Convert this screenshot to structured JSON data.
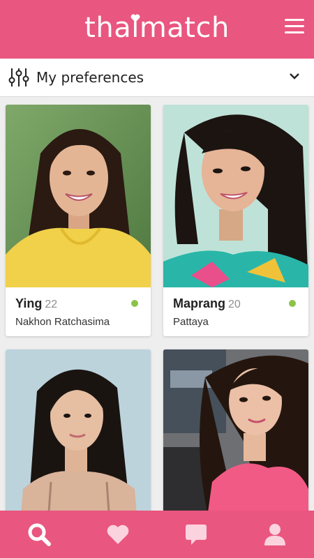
{
  "app": {
    "brand": "thaimatch",
    "colors": {
      "primary": "#e9567f",
      "online": "#8bc34a",
      "nav_icon": "#fbd3df"
    }
  },
  "header": {
    "menu_icon": "hamburger-icon"
  },
  "preferences": {
    "label": "My preferences",
    "icon": "sliders-icon",
    "toggle_icon": "chevron-down-icon"
  },
  "profiles": [
    {
      "name": "Ying",
      "age": "22",
      "city": "Nakhon Ratchasima",
      "online": true
    },
    {
      "name": "Maprang",
      "age": "20",
      "city": "Pattaya",
      "online": true
    },
    {
      "name": "",
      "age": "",
      "city": "",
      "online": false
    },
    {
      "name": "",
      "age": "",
      "city": "",
      "online": false
    }
  ],
  "bottom_nav": [
    {
      "id": "search",
      "icon": "search-icon",
      "active": true
    },
    {
      "id": "likes",
      "icon": "heart-icon",
      "active": false
    },
    {
      "id": "messages",
      "icon": "chat-icon",
      "active": false
    },
    {
      "id": "profile",
      "icon": "user-icon",
      "active": false
    }
  ]
}
